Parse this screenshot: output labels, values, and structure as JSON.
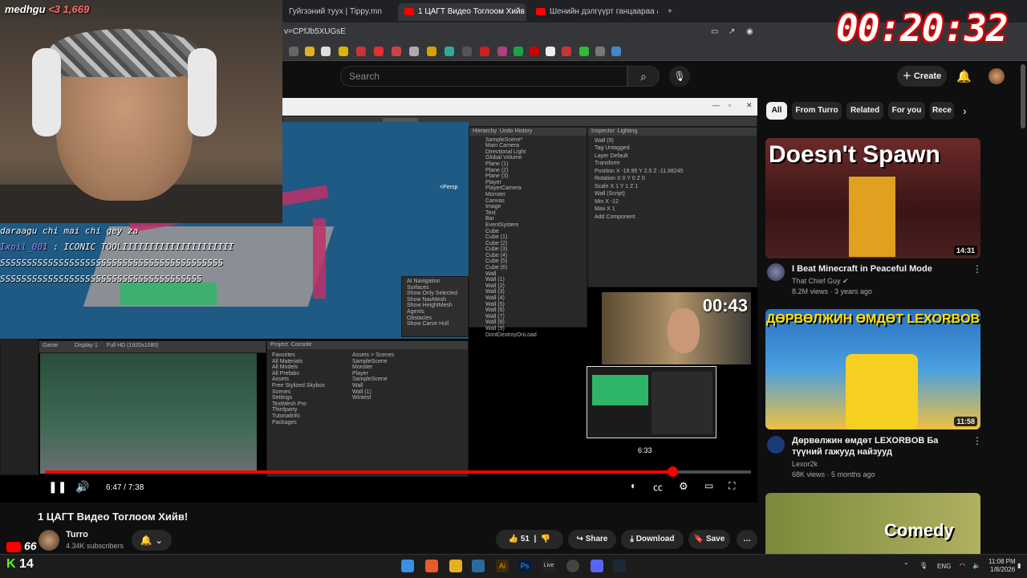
{
  "overlay": {
    "streamer": "medhgu",
    "hearts": "<3",
    "hearts_count": "1,669",
    "chat": [
      {
        "user": "",
        "text": "daraagu chi mai chi gey za"
      },
      {
        "user": "Ixoil_001",
        "text": ": ICONIC TOOLIIIIIIIIIIIIIIIIIIIII"
      },
      {
        "user": "",
        "text": "SSSSSSSSSSSSSSSSSSSSSSSSSSSSSSSSSSSSSSSSSS"
      },
      {
        "user": "",
        "text": "SSSSSSSSSSSSSSSSSSSSSSSSSSSSSSSSSSSSSS"
      }
    ],
    "timer": "00:20:32",
    "youtube_count": "66",
    "kick_count": "14"
  },
  "browser": {
    "tabs": [
      {
        "label": "Гуйгзэний туух | Tippy.mn"
      },
      {
        "label": "1 ЦАГТ Видео Тоглоом Хийв"
      },
      {
        "label": "Шенийн дэлгүүрт ганцаараа ажилл"
      }
    ],
    "new_tab": "+",
    "url": "v=CPfJb5XUGsE"
  },
  "yt_header": {
    "search_placeholder": "Search",
    "create_label": "Create"
  },
  "player": {
    "current_time": "6:47",
    "duration": "7:38",
    "timecode": "6:47 / 7:38",
    "hover_time": "6:33",
    "progress_fraction": 0.889,
    "inset_timer": "00:43",
    "unity": {
      "hierarchy_title": "Hierarchy",
      "undo_title": "Undo History",
      "inspector_title": "Inspector",
      "lighting_title": "Lighting",
      "project_title": "Project",
      "console_title": "Console",
      "game_tab": "Game",
      "animation_tab": "Animation",
      "hierarchy": [
        "SampleScene*",
        "Main Camera",
        "Directional Light",
        "Global Volume",
        "Plane (1)",
        "Plane (2)",
        "Plane (3)",
        "Player",
        "PlayerCamera",
        "Monster",
        "Canvas",
        "Image",
        "Text",
        "Bar",
        "EventSystem",
        "Cube",
        "Cube (1)",
        "Cube (2)",
        "Cube (3)",
        "Cube (4)",
        "Cube (5)",
        "Cube (6)",
        "Wall",
        "Wall (1)",
        "Wall (2)",
        "Wall (3)",
        "Wall (4)",
        "Wall (5)",
        "Wall (6)",
        "Wall (7)",
        "Wall (8)",
        "Wall (9)",
        "DontDestroyOnLoad"
      ],
      "inspector": [
        "Wall (9)",
        "Tag Untagged",
        "Layer Default",
        "Transform",
        "Position  X -19.95   Y 2.5   Z -11.98245",
        "Rotation  X 0   Y 0   Z 0",
        "Scale     X 1   Y 1   Z 1",
        "Wall (Script)",
        "Min X  -12",
        "Max X  1",
        "Add Component"
      ],
      "project": [
        "Favorites",
        "All Materials",
        "All Models",
        "All Prefabs",
        "Assets",
        "Free Stylized Skybox",
        "Scenes",
        "Settings",
        "TextMesh Pro",
        "Thirdparty",
        "TutorialInfo",
        "Packages"
      ],
      "scenes": [
        "Assets > Scenes",
        "SampleScene",
        "Monster",
        "Player",
        "SampleScene",
        "Wall",
        "Wall (1)",
        "Wintest"
      ],
      "ai_nav": [
        "AI Navigation",
        "Surfaces",
        "Show Only Selected",
        "Show NavMesh",
        "Show HeightMesh",
        "Agents",
        "Obstacles",
        "Show Carve Hull"
      ],
      "game_display": "Display 1",
      "game_res": "Full HD (1920x1080)",
      "persp": "<Persp"
    }
  },
  "video": {
    "title": "1 ЦАГТ Видео Тоглоом Хийв!",
    "channel": "Turro",
    "subscribers": "4.34K subscribers",
    "likes": "51",
    "share": "Share",
    "download": "Download",
    "save": "Save",
    "more": "…"
  },
  "chips": [
    "All",
    "From Turro",
    "Related",
    "For you",
    "Rece"
  ],
  "recommendations": [
    {
      "title": "I Beat Minecraft in Peaceful Mode",
      "channel": "That Chief Guy",
      "meta": "8.2M views · 3 years ago",
      "duration": "14:31",
      "thumb_text": "Doesn't Spawn"
    },
    {
      "title": "Дөрвөлжин өмдөт LEXORBOB Ба түүний гажууд найзууд",
      "channel": "Lexor2k",
      "meta": "68K views · 5 months ago",
      "duration": "11:58",
      "thumb_text": "ДӨРВӨЛЖИН ӨМДӨТ LEXORBOB"
    },
    {
      "title": "",
      "channel": "",
      "meta": "",
      "duration": "",
      "thumb_text": "Comedy"
    }
  ],
  "taskbar": {
    "lang": "ENG",
    "time": "11:08 PM",
    "date": "1/8/2026"
  },
  "colors": {
    "accent": "#ff0000",
    "kick": "#53fc18",
    "background": "#0f0f0f"
  }
}
